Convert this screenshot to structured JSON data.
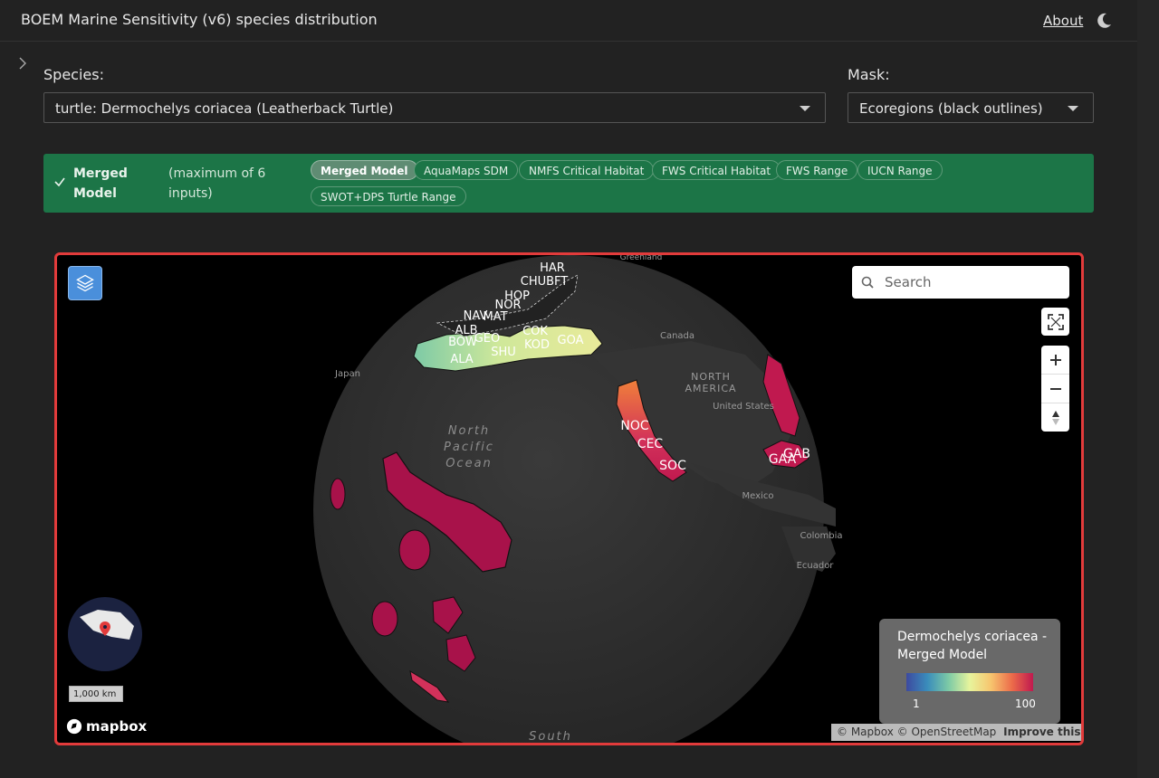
{
  "header": {
    "title": "BOEM Marine Sensitivity (v6) species distribution",
    "about_label": "About",
    "theme_icon": "moon-icon"
  },
  "filters": {
    "species_label": "Species:",
    "species_value": "turtle: Dermochelys coriacea (Leatherback Turtle)",
    "mask_label": "Mask:",
    "mask_value": "Ecoregions (black outlines)"
  },
  "model": {
    "selected_title": "Merged Model",
    "note": "(maximum of 6 inputs)",
    "chips": [
      {
        "label": "Merged Model",
        "active": true
      },
      {
        "label": "AquaMaps SDM",
        "active": false
      },
      {
        "label": "NMFS Critical Habitat",
        "active": false
      },
      {
        "label": "FWS Critical Habitat",
        "active": false
      },
      {
        "label": "FWS Range",
        "active": false
      },
      {
        "label": "IUCN Range",
        "active": false
      },
      {
        "label": "SWOT+DPS Turtle Range",
        "active": false
      }
    ]
  },
  "map": {
    "search_placeholder": "Search",
    "scale_label": "1,000 km",
    "mapbox_word": "mapbox",
    "attribution": "© Mapbox © OpenStreetMap",
    "improve_label": "Improve this map",
    "legend": {
      "title": "Dermochelys coriacea - Merged Model",
      "min": "1",
      "max": "100",
      "colors": [
        "#3d4aa0",
        "#3a8dbb",
        "#7dcaa6",
        "#e7f49c",
        "#f7c56e",
        "#ec6b4a",
        "#c0194f"
      ]
    },
    "ecoregion_labels": [
      "HAR",
      "CHUBFT",
      "HOP",
      "NOR",
      "NAV",
      "MAT",
      "ALB",
      "GEO",
      "BOW",
      "SHU",
      "ALA",
      "COK",
      "KOD",
      "GOA",
      "NOC",
      "CEC",
      "SOC",
      "GAB",
      "GAA"
    ],
    "place_labels": [
      "Canada",
      "NORTH",
      "AMERICA",
      "United States",
      "Mexico",
      "Colombia",
      "Ecuador",
      "Japan",
      "North",
      "Pacific",
      "Ocean",
      "South",
      "Greenland"
    ]
  }
}
